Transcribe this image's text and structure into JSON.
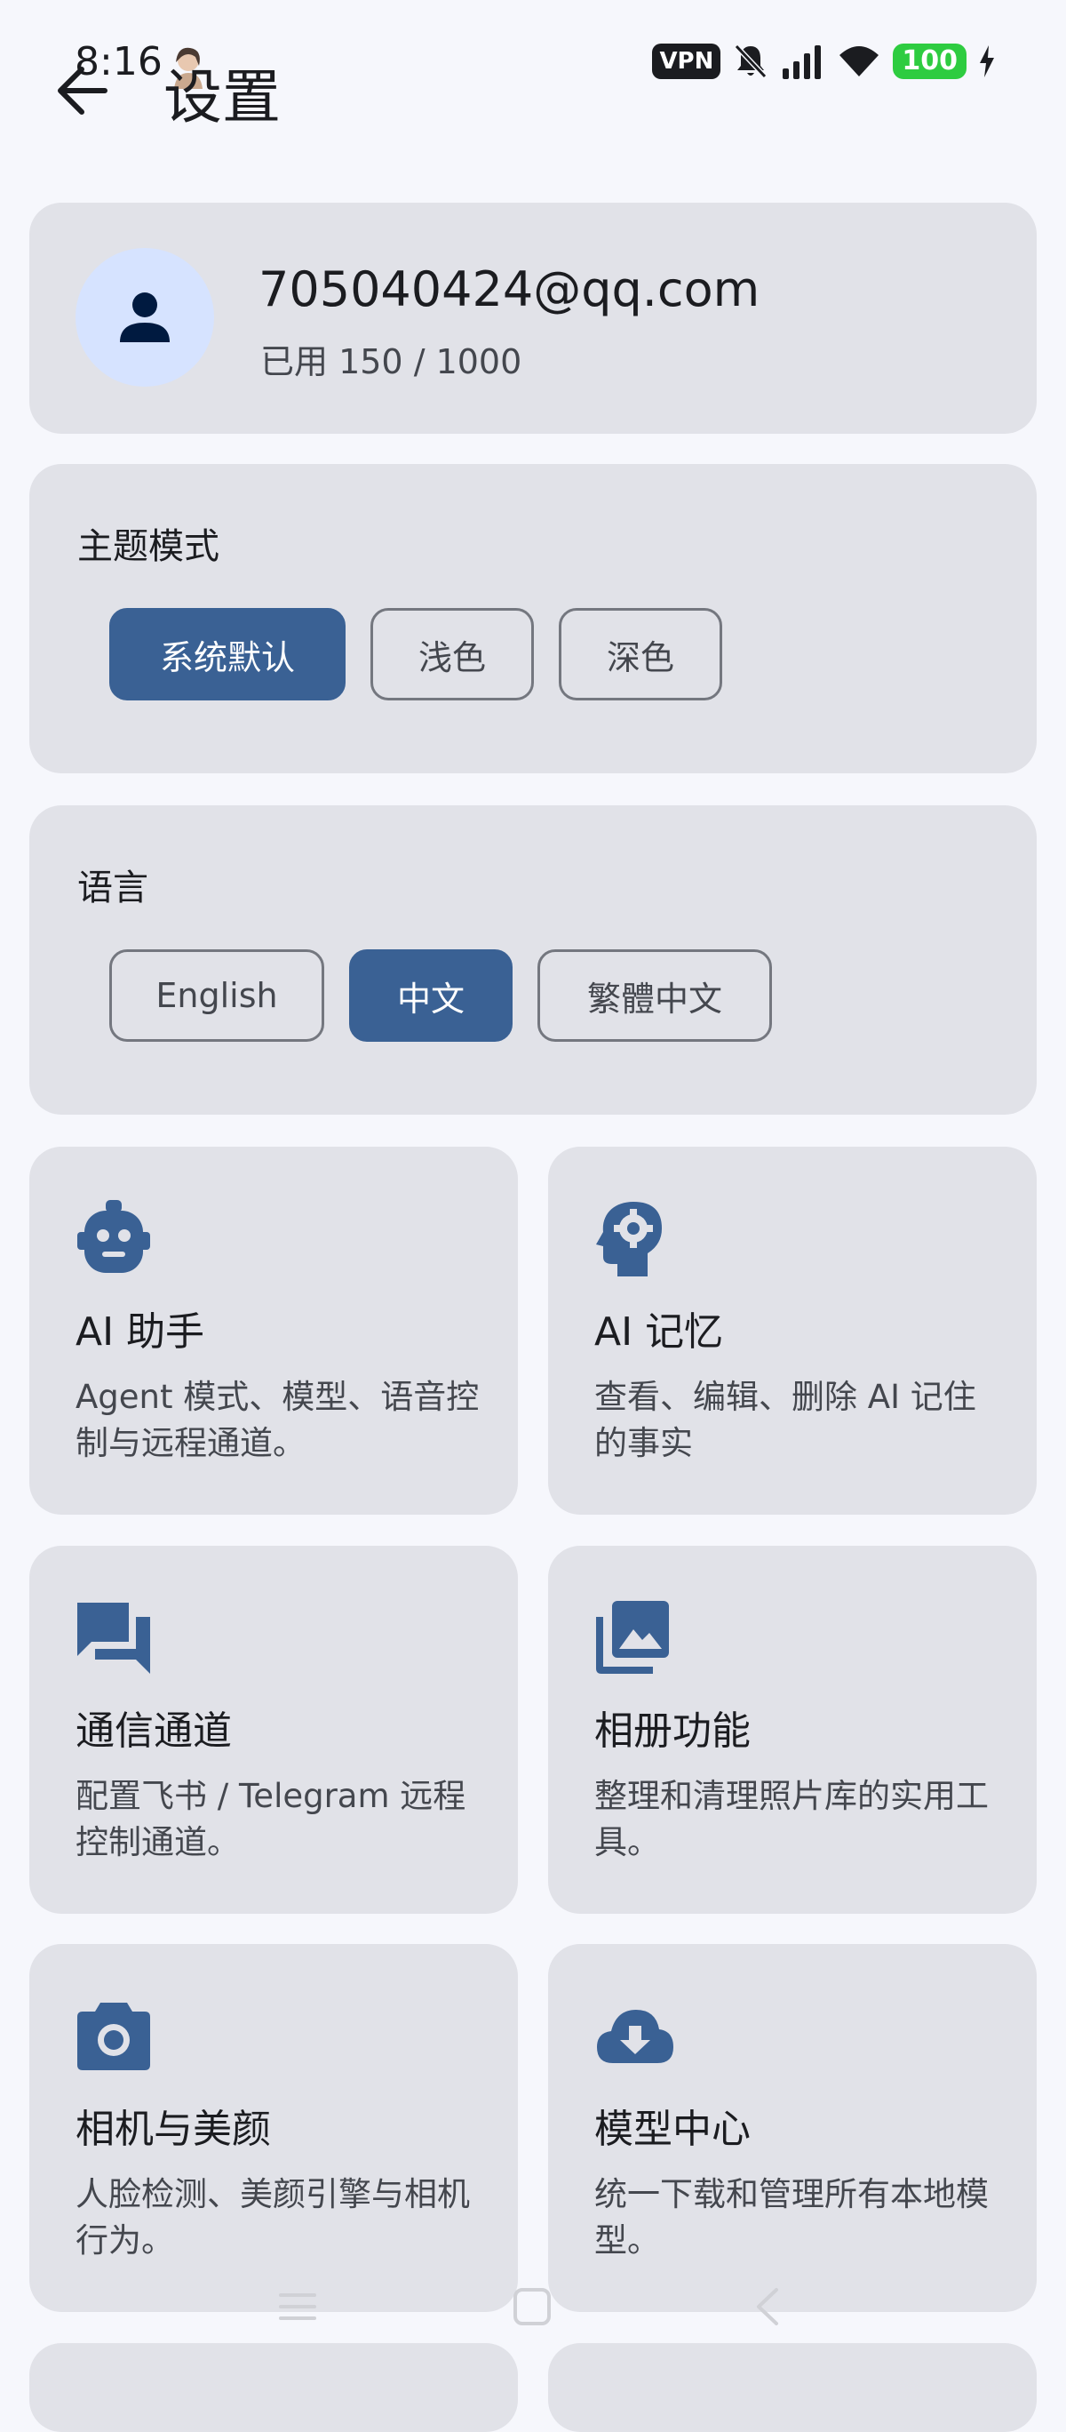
{
  "status_bar": {
    "time": "8:16",
    "vpn": "VPN",
    "battery": "100"
  },
  "header": {
    "title": "设置"
  },
  "account": {
    "email": "705040424@qq.com",
    "usage": "已用 150 / 1000"
  },
  "theme": {
    "title": "主题模式",
    "options": [
      "系统默认",
      "浅色",
      "深色"
    ],
    "selected": "系统默认"
  },
  "language": {
    "title": "语言",
    "options": [
      "English",
      "中文",
      "繁體中文"
    ],
    "selected": "中文"
  },
  "features": [
    {
      "icon": "robot-icon",
      "title": "AI 助手",
      "desc": "Agent 模式、模型、语音控制与远程通道。"
    },
    {
      "icon": "brain-gear-icon",
      "title": "AI 记忆",
      "desc": "查看、编辑、删除 AI 记住的事实"
    },
    {
      "icon": "chat-bubbles-icon",
      "title": "通信通道",
      "desc": "配置飞书 / Telegram 远程控制通道。"
    },
    {
      "icon": "photo-library-icon",
      "title": "相册功能",
      "desc": "整理和清理照片库的实用工具。"
    },
    {
      "icon": "camera-icon",
      "title": "相机与美颜",
      "desc": "人脸检测、美颜引擎与相机行为。"
    },
    {
      "icon": "cloud-download-icon",
      "title": "模型中心",
      "desc": "统一下载和管理所有本地模型。"
    }
  ],
  "colors": {
    "accent": "#3a6194",
    "card": "#e1e2e8",
    "background": "#f6f7fc"
  }
}
